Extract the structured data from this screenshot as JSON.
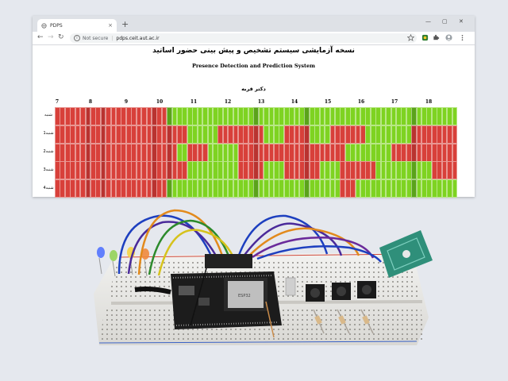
{
  "browser": {
    "tab_title": "PDPS",
    "tab_close": "×",
    "new_tab": "+",
    "nav": {
      "back": "←",
      "forward": "→",
      "reload": "↻"
    },
    "security": "Not secure",
    "separator": "|",
    "url": "pdps.ceit.aut.ac.ir",
    "window_controls": {
      "minimize": "—",
      "maximize": "▢",
      "close": "✕"
    },
    "extension_icons": [
      "star-icon",
      "extension-icon",
      "puzzle-icon",
      "profile-avatar",
      "menu-icon"
    ]
  },
  "page": {
    "title_fa": "نسخه آزمایشی سیستم تشخیص و پیش بینی حضور اساتید",
    "title_en": "Presence Detection and Prediction System",
    "person": "دکتر قربه",
    "hours": [
      "7",
      "8",
      "9",
      "10",
      "11",
      "12",
      "13",
      "14",
      "15",
      "16",
      "17",
      "18"
    ],
    "days": [
      "شنبه",
      "شنبه1",
      "شنبه2",
      "شنبه3",
      "شنبه4"
    ],
    "colors": {
      "absent": "#d8403a",
      "absent_dark": "#b93330",
      "present": "#7ed321",
      "present_dark": "#5aa31a"
    },
    "grid_rows": [
      "rrrrrrrrrrrrrrrrrrrrrrggggggggggggggggggggggggggggggggggggggggggggggggggggggggg",
      "rrrrrrrrrrrrrrrrrrrrrrrrrrggggggrrrrrrrrrggggrrrrrggggrrrrrrrgggggggggrrrrrrrrr",
      "rrrrrrrrrrrrrrrrrrrrrrrrggrrrrggggggrrrrrrrrrrrrrrrrrrrrrgggggggggrrrrrrrrrrrrr",
      "rrrrrrrrrrrrrrrrrrrrrrrrrrggggggggggrrrrrggggrrrrrrrggggrrrrrrrgggggggggggrrrrr",
      "rrrrrrrrrrrrrrrrrrrrrrggggggggggggggggggggggggggggggggggrrrgggggggggggggggggggg"
    ],
    "dark_columns": [
      6,
      9,
      19,
      22,
      39,
      49,
      70
    ]
  },
  "photo": {
    "description_icons": [
      "breadboard",
      "esp32-board",
      "led-red",
      "led-yellow",
      "led-green",
      "led-blue",
      "push-button",
      "rfid-module",
      "jumper-wires"
    ]
  }
}
